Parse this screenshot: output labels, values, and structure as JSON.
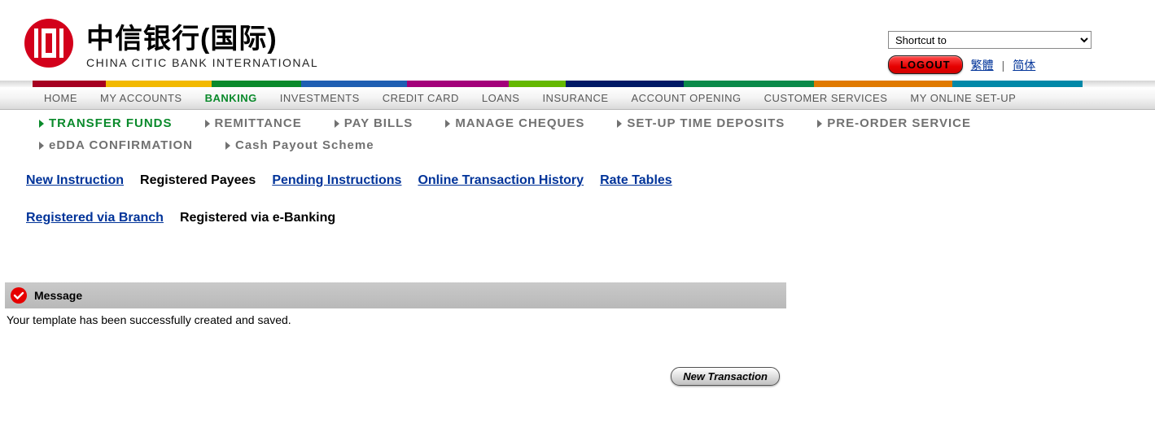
{
  "logo": {
    "cn": "中信银行(国际)",
    "en": "CHINA CITIC BANK INTERNATIONAL"
  },
  "header": {
    "shortcut_default": "Shortcut to",
    "logout": "LOGOUT",
    "lang_trad": "繁體",
    "lang_simp": "简体",
    "lang_sep": "|"
  },
  "topnav": [
    {
      "label": "HOME"
    },
    {
      "label": "MY ACCOUNTS"
    },
    {
      "label": "BANKING",
      "active": true
    },
    {
      "label": "INVESTMENTS"
    },
    {
      "label": "CREDIT CARD"
    },
    {
      "label": "LOANS"
    },
    {
      "label": "INSURANCE"
    },
    {
      "label": "ACCOUNT OPENING"
    },
    {
      "label": "CUSTOMER SERVICES"
    },
    {
      "label": "MY ONLINE SET-UP"
    }
  ],
  "subnav": [
    {
      "label": "TRANSFER  FUNDS",
      "active": true
    },
    {
      "label": "REMITTANCE"
    },
    {
      "label": "PAY BILLS"
    },
    {
      "label": "MANAGE  CHEQUES"
    },
    {
      "label": "SET-UP  TIME  DEPOSITS"
    },
    {
      "label": "PRE-ORDER  SERVICE"
    },
    {
      "label": "eDDA  CONFIRMATION"
    },
    {
      "label": "Cash  Payout  Scheme"
    }
  ],
  "tertiary1": [
    {
      "label": "New Instruction ",
      "current": false
    },
    {
      "label": "Registered Payees",
      "current": true
    },
    {
      "label": "Pending Instructions ",
      "current": false
    },
    {
      "label": "Online Transaction History ",
      "current": false
    },
    {
      "label": "Rate Tables",
      "current": false
    }
  ],
  "tertiary2": [
    {
      "label": "Registered via Branch ",
      "current": false
    },
    {
      "label": "Registered via e-Banking",
      "current": true
    }
  ],
  "message": {
    "title": "Message",
    "body": "Your template has been successfully created and saved."
  },
  "buttons": {
    "new_transaction": "New Transaction"
  }
}
